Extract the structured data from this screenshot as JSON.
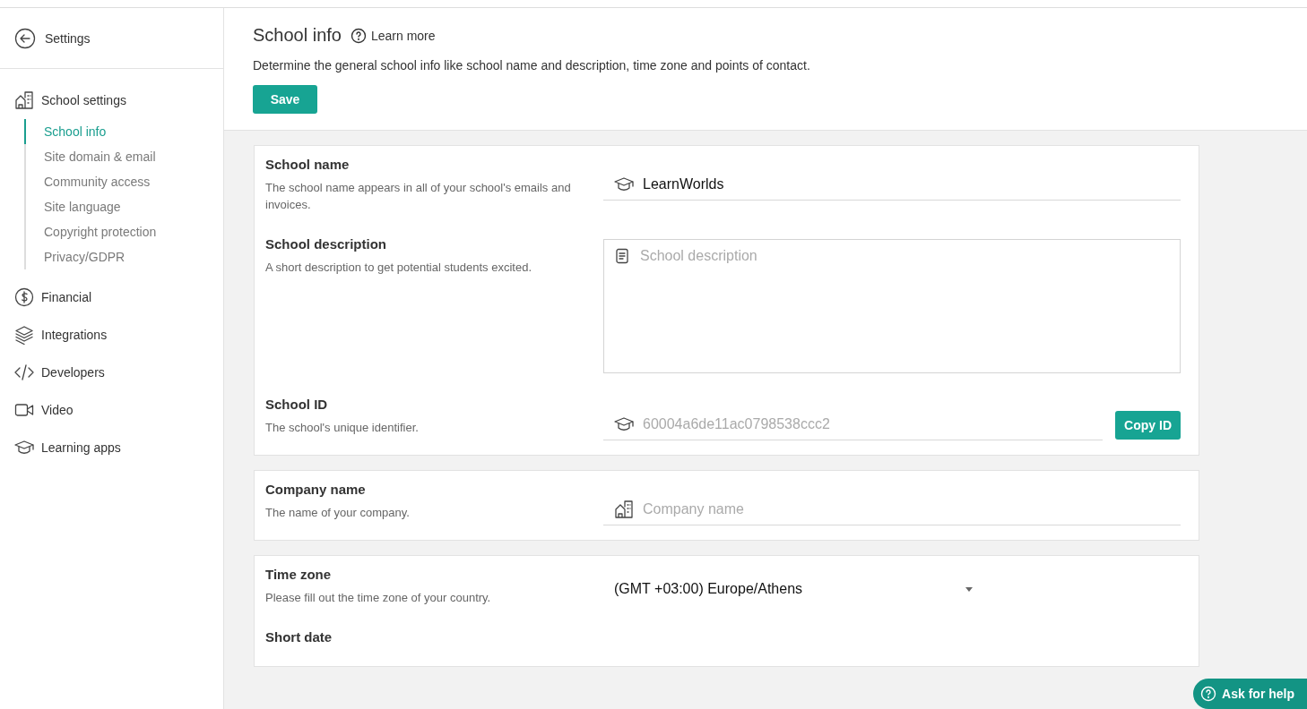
{
  "sidebar": {
    "back_label": "Settings",
    "items": [
      {
        "label": "School settings",
        "children": [
          {
            "label": "School info",
            "selected": true
          },
          {
            "label": "Site domain & email",
            "selected": false
          },
          {
            "label": "Community access",
            "selected": false
          },
          {
            "label": "Site language",
            "selected": false
          },
          {
            "label": "Copyright protection",
            "selected": false
          },
          {
            "label": "Privacy/GDPR",
            "selected": false
          }
        ]
      },
      {
        "label": "Financial"
      },
      {
        "label": "Integrations"
      },
      {
        "label": "Developers"
      },
      {
        "label": "Video"
      },
      {
        "label": "Learning apps"
      }
    ]
  },
  "header": {
    "title": "School info",
    "learn_more": "Learn more",
    "description": "Determine the general school info like school name and description, time zone and points of contact.",
    "save_button": "Save"
  },
  "cards": [
    {
      "fields": [
        {
          "kind": "school",
          "title": "School name",
          "description": "The school name appears in all of your school's emails and invoices.",
          "value": "LearnWorlds"
        },
        {
          "kind": "area",
          "title": "School description",
          "description": "A short description to get potential students excited.",
          "placeholder": "School description"
        },
        {
          "kind": "copy",
          "title": "School ID",
          "description": "The school's unique identifier.",
          "value": "60004a6de11ac0798538ccc2",
          "button": "Copy ID"
        }
      ]
    },
    {
      "fields": [
        {
          "kind": "company",
          "title": "Company name",
          "description": "The name of your company.",
          "placeholder": "Company name"
        }
      ]
    },
    {
      "fields": [
        {
          "kind": "select",
          "title": "Time zone",
          "description": "Please fill out the time zone of your country.",
          "value": "(GMT +03:00) Europe/Athens"
        },
        {
          "kind": "heading",
          "title": "Short date"
        }
      ]
    }
  ],
  "help_button": "Ask for help"
}
